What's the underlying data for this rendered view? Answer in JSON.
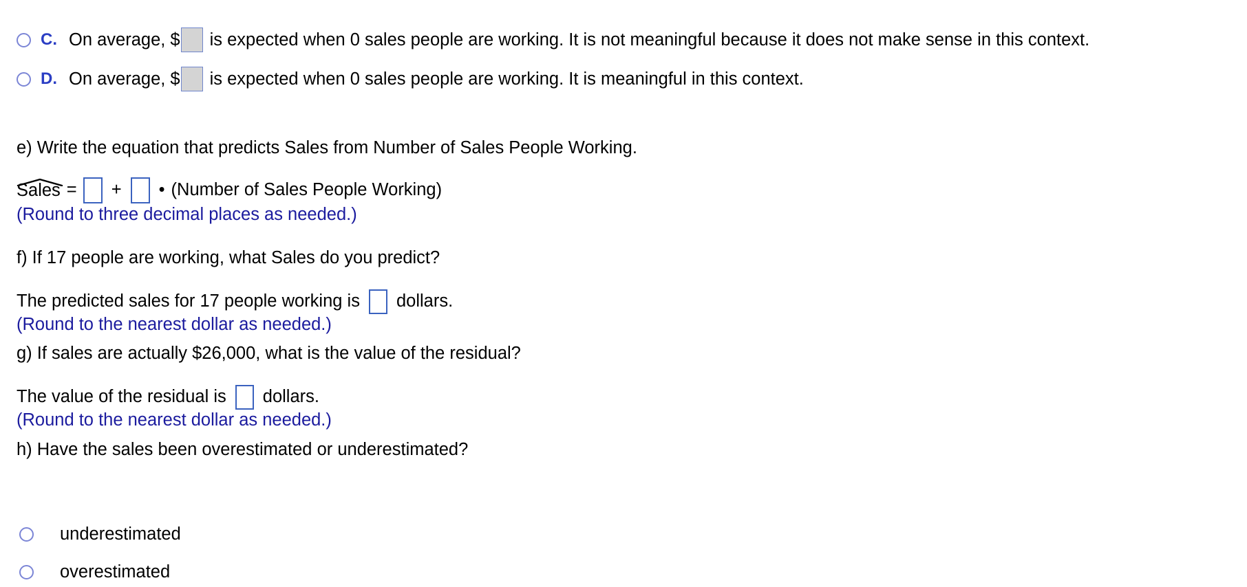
{
  "colors": {
    "text": "#000000",
    "hint_blue": "#1b1b9e",
    "letter_blue": "#2b3ec4",
    "radio_ring": "#7b85d6",
    "box_border": "#3a62bf",
    "box_fill_gray": "#d4d4d4"
  },
  "choices": [
    {
      "letter": "C.",
      "radio": "radio-unselected",
      "text_before": "On average, $",
      "text_after": "is expected when 0 sales people are working. It is not meaningful because it does not make sense in this context.",
      "input_value": ""
    },
    {
      "letter": "D.",
      "radio": "radio-unselected",
      "text_before": "On average, $",
      "text_after": "is expected when 0 sales people are working. It is meaningful in this context.",
      "input_value": ""
    }
  ],
  "part_e": {
    "prompt": "e) Write the equation that predicts Sales from Number of Sales People Working.",
    "equation": {
      "lhs": "Sales",
      "hat": "hat-accent",
      "equals": "=",
      "intercept_value": "",
      "plus": "+",
      "slope_value": "",
      "multiply": "•",
      "variable": "(Number of Sales People Working)"
    },
    "hint": "(Round to three decimal places as needed.)"
  },
  "part_f": {
    "prompt": "f) If 17 people are working, what Sales do you predict?",
    "answer_before": "The predicted sales for 17 people working is",
    "answer_value": "",
    "answer_after": "dollars.",
    "hint": "(Round to the nearest dollar as needed.)"
  },
  "part_g": {
    "prompt": "g) If sales are actually $26,000, what is the value of the residual?",
    "answer_before": "The value of the residual is",
    "answer_value": "",
    "answer_after": "dollars.",
    "hint": "(Round to the nearest dollar as needed.)"
  },
  "part_h": {
    "prompt": "h) Have the sales been overestimated or underestimated?",
    "options": [
      {
        "label": "underestimated",
        "radio": "radio-unselected"
      },
      {
        "label": "overestimated",
        "radio": "radio-unselected"
      }
    ]
  }
}
